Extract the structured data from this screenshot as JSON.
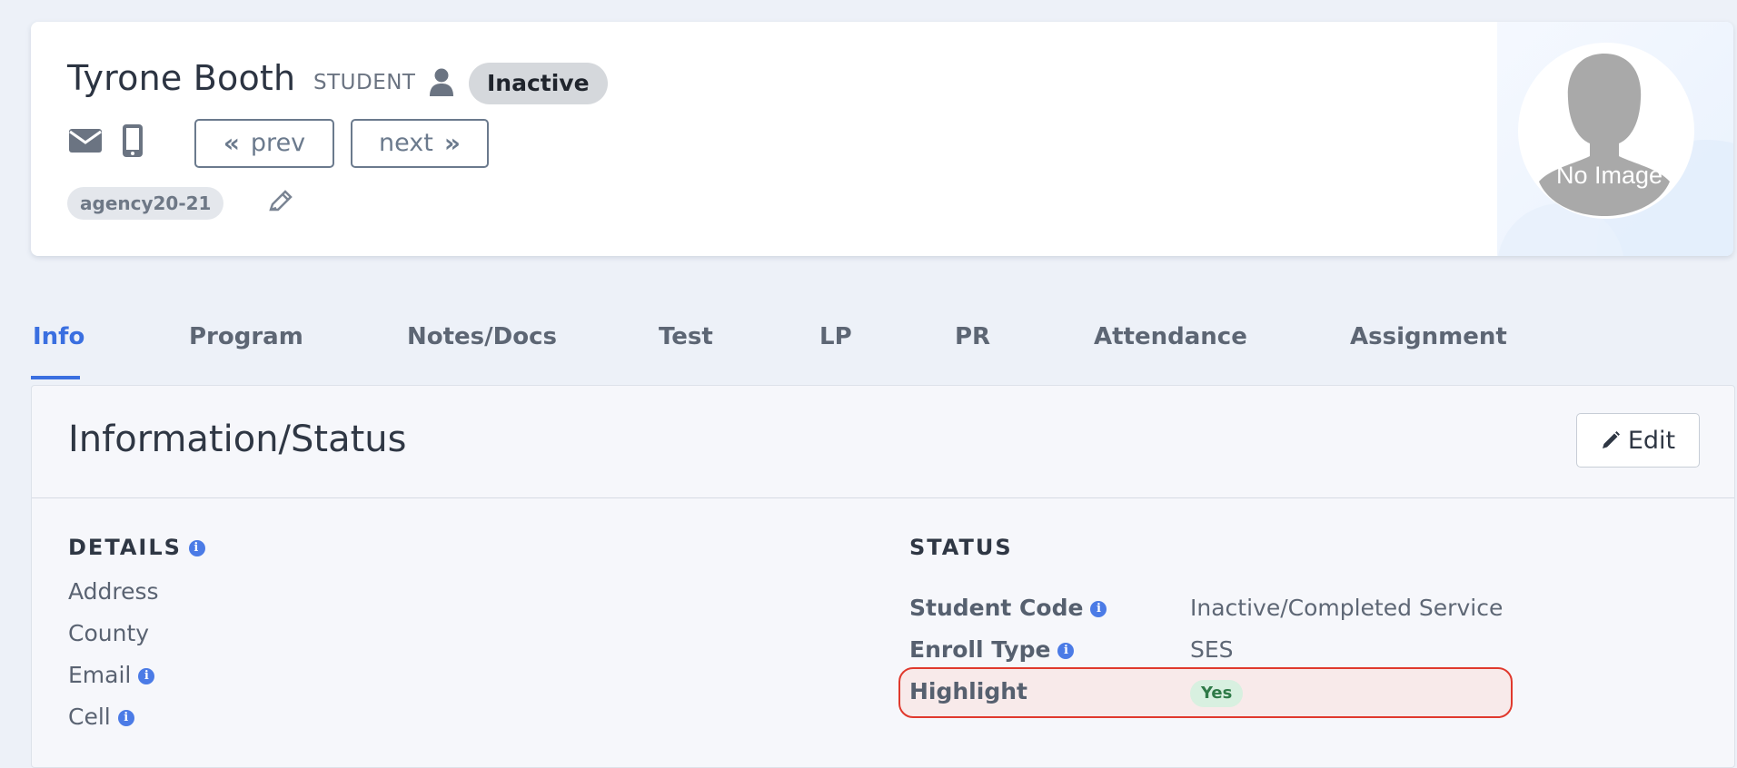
{
  "profile": {
    "name": "Tyrone Booth",
    "role": "STUDENT",
    "status": "Inactive",
    "prev_label": "prev",
    "next_label": "next",
    "tag": "agency20-21",
    "avatar_text": "No Image"
  },
  "tabs": [
    {
      "label": "Info",
      "active": true
    },
    {
      "label": "Program"
    },
    {
      "label": "Notes/Docs"
    },
    {
      "label": "Test"
    },
    {
      "label": "LP"
    },
    {
      "label": "PR"
    },
    {
      "label": "Attendance"
    },
    {
      "label": "Assignment"
    }
  ],
  "panel": {
    "title": "Information/Status",
    "edit_label": "Edit"
  },
  "details": {
    "heading": "DETAILS",
    "fields": [
      "Address",
      "County",
      "Email",
      "Cell"
    ]
  },
  "status": {
    "heading": "STATUS",
    "rows": [
      {
        "label": "Student Code",
        "value": "Inactive/Completed Service"
      },
      {
        "label": "Enroll Type",
        "value": "SES"
      },
      {
        "label": "Highlight",
        "value": "Yes"
      }
    ]
  },
  "colors": {
    "accent": "#3a6fe0",
    "highlight_border": "#e0392d",
    "yes_badge": "#d8f0e0"
  }
}
